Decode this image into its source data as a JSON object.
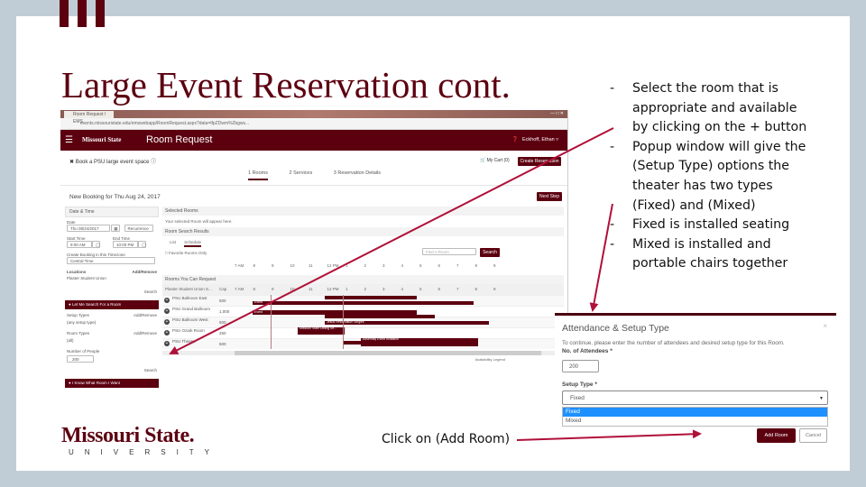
{
  "slide": {
    "title": "Large Event Reservation cont.",
    "bullets": [
      "Select the room that is appropriate and available by clicking on the + button",
      "Popup window will give the (Setup Type) options the theater has two types (Fixed) and (Mixed)",
      "Fixed is installed seating",
      "Mixed is installed and portable chairs together"
    ],
    "caption": "Click on (Add Room)",
    "logo": {
      "main": "Missouri State.",
      "sub": "UNIVERSITY"
    },
    "colors": {
      "maroon": "#5c0010",
      "background": "#c1cdd6",
      "arrow": "#b0103a"
    }
  },
  "browser": {
    "tab_label": "Room Request / EMS",
    "address": "events.missouristate.edu/emswebapp/RoomRequest.aspx?data=lfpZDwm%2bgws...",
    "app": {
      "brand": "Missouri State",
      "title": "Room Request",
      "user": "Eckhoff, Ethan"
    },
    "booking_title": "Book a PSU large event space",
    "steps": [
      "1 Rooms",
      "2 Services",
      "3 Reservation Details"
    ],
    "my_cart": "My Cart (0)",
    "create_reservation": "Create Reservation",
    "new_booking": "New Booking for Thu Aug 24, 2017",
    "next_step": "Next Step",
    "sidebar": {
      "date_time_header": "Date & Time",
      "date_label": "Date",
      "date_value": "Thu 08/24/2017",
      "recurrence": "Recurrence",
      "start_label": "Start Time",
      "start_value": "9:00 AM",
      "end_label": "End Time",
      "end_value": "10:00 PM",
      "timezone_label": "Create Booking in this Timezone",
      "timezone_value": "Central Time",
      "locations_label": "Locations",
      "locations_action": "Add/Remove",
      "locations_value": "Plaster Student Union",
      "search": "Search",
      "adv_header": "Let Me Search For a Room",
      "setup_label": "Setup Types",
      "setup_action": "Add/Remove",
      "setup_value": "(any setup type)",
      "room_types_label": "Room Types",
      "room_types_action": "Add/Remove",
      "room_types_value": "(all)",
      "people_label": "Number of People",
      "people_value": "200",
      "search2": "Search",
      "know_header": "I Know What Room I Want"
    },
    "main": {
      "selected_rooms": "Selected Rooms",
      "selected_hint": "Your selected Room will appear here.",
      "search_results": "Room Search Results",
      "view_tabs": [
        "List",
        "Schedule"
      ],
      "favorite": "Favorite Rooms Only",
      "find_placeholder": "Find A Room",
      "search_btn": "Search",
      "hours": [
        "7 AM",
        "8",
        "9",
        "10",
        "11",
        "12 PM",
        "1",
        "2",
        "3",
        "4",
        "5",
        "6",
        "7",
        "8",
        "9"
      ],
      "rooms_header": "Rooms You Can Request",
      "col_room": "Plaster Student Union S...",
      "col_cap": "Cap",
      "rooms": [
        {
          "name": "PSU Ballroom East",
          "cap": "500"
        },
        {
          "name": "PSU Grand Ballroom",
          "cap": "1,000"
        },
        {
          "name": "PSU Ballroom West",
          "cap": "500"
        },
        {
          "name": "PSU Ozark Room",
          "cap": "250"
        },
        {
          "name": "PSU Theater",
          "cap": "500"
        }
      ],
      "event_labels": [
        "Event",
        "Event",
        "Jesus Reformation Singles",
        "Missouri State Dining Se...",
        "Assembly Event Invitation"
      ],
      "legend": "Availability Legend"
    }
  },
  "modal": {
    "title": "Attendance & Setup Type",
    "close": "×",
    "description": "To continue, please enter the number of attendees and desired setup type for this Room.",
    "attendees_label": "No. of Attendees *",
    "attendees_value": "200",
    "setup_label": "Setup Type *",
    "setup_value": "Fixed",
    "options": [
      "Fixed",
      "Mixed"
    ],
    "highlighted_option": "Fixed",
    "add_room": "Add Room",
    "cancel": "Cancel"
  }
}
